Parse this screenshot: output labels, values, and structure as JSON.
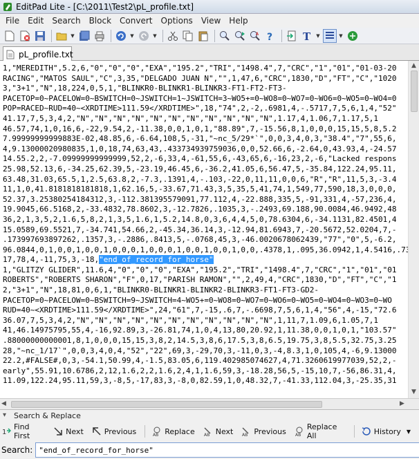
{
  "window": {
    "title": "EditPad Lite - [C:\\2011\\Test2\\pL_profile.txt]"
  },
  "menu": [
    "File",
    "Edit",
    "Search",
    "Block",
    "Convert",
    "Options",
    "View",
    "Help"
  ],
  "tab": {
    "label": "pL_profile.txt"
  },
  "editor": {
    "lines_before": [
      "1,\"MEREDITH\",5.2,6,\"0\",\"0\",\"0\",\"EXA\",\"195.2\",\"TRI\",\"1498.4\",7,\"CRC\",\"1\",\"01\",\"01-03-20",
      "RACING\",\"MATOS SAUL\",\"C\",3,35,\"DELGADO JUAN N\",\"\",1,47,6,\"CRC\",1830,\"D\",\"FT\",\"C\",\"1020",
      "3,\"3+1\",\"N\",18,224,0,5,1,\"BLINKR0-BLINKR1-BLINKR3-FT1-FT2-FT3-",
      "PACETOP=0~PACELOW=0~BSWITCH=0~JSWITCH=1~JSWITCH=3~WO5+=0~WO8=0~WO7=0~WO6=0~WO5=0~WO4=0",
      "POP=RACED~RUD=40~<XRDTIME>111.59</XRDTIME>\",18,\"74\",2,-2,.6981,4,-.5717,7,5,6,1,4,\"52\"",
      "41.17,7,5,3,4,2,\"N\",\"N\",\"N\",\"N\",\"N\",\"N\",\"N\",\"N\",\"N\",\"N\",\"N\",1.17,4,1.06,7,1.17,5,1",
      "46.57,74,1,0,16,6,-22,9.54,2,-11.38,0,0,1,0,1,\"88.89\",7,-15.56,8,1,0,0,0,15,15,5,8,5.2",
      "7.99999999999883E-02,48.85,6,-6.64,108,5,-31,\"~nc_5/29*`\",0,0,3,4,0,3,\"38.4\",\"7\",55,6,",
      "4,9.13000020980835,1,0,18,74,63,43,.433734939759036,0,0,52.66,6,-2.64,0,43.93,4,-24.57",
      "14.55.2,2,-7.09999999999999,52,2,-6,33,4,-61,55,6,-43,65,6,-16,23,2,-6,\"Lacked respons",
      "25.98,52.13,6,-34.25,62.39,5,-23.19,46.45,6,-36.2,41.05,6,56.47,5,-35.84,122.24,95.11,",
      "63.48,31.03,65.5,1,2.5,63.8,2,-7.3,.1391,4,-.103,-22,0,11,11,0,0,6,\"R\",\"R\",11,5,3,-3.4",
      "11,1,0,41.8181818181818,1,62.16,5,-33.67,71.43,3,5,35,5,41,74,1,549,77,590,18,3,0,0,0,",
      "52.37,3.25380254184312,3,-112.381395579091,77.112,4,-22.888,335,5,-91,331,4,-57,236,4,",
      "19.9045,66.5168,2,-33.4832,78.8602,3,-12.7826,.1035,3,-.2493,69.188,90.0084,46.9492,48",
      "36,2,1,3,5,2,1.6,5,8,2,1,3,5,1.6,1,5.2,14.8,0,3,6,4,4,5,0,78.6304,6,-34.1131,82.4501,4",
      "15.0589,69.5521,7,-34.741,54.66,2,-45.34,36.14,3,-12.94,81.6943,7,-20.5672,52.0204,7,-",
      ".173997693897262,.1357,3,-.2886,.8413,5,-.0768,45,3,-46.0020678062439,\"77\",\"0\",5,-6.2,",
      "96.0844,0,1,0,0,1,0,0,1,0,0,0,1,0,0,0,1,0,0,1,0,0,1,0,0,.4378,1,.095,36.0942,1,4.5416,.7346,",
      "17,78,4,-11,75,3,-18,"
    ],
    "selected_text": "\"end_of_record_for_horse\"",
    "lines_after": [
      "1,\"GLITZY GLIDER\",11.6,4,\"0\",\"0\",\"0\",\"EXA\",\"195.2\",\"TRI\",\"1498.4\",7,\"CRC\",\"1\",\"01\",\"01",
      "ROBERTS\",\"ROBERTS SHARON\",\"F\",0,17,\"PARISH RAMON\",\"\",2,49,4,\"CRC\",1830,\"D\",\"FT\",\"C\",\"1",
      "2,\"3+1\",\"N\",18,81,0,6,1,\"BLINKR0-BLINKR1-BLINKR2-BLINKR3-FT1-FT3-GD2-",
      "PACETOP=0~PACELOW=0~BSWITCH=9~JSWITCH=4~WO5+=0~WO8=0~WO7=0~WO6=0~WO5=0~WO4=0~WO3=0~WO",
      "RUD=40~<XRDTIME>111.59</XRDTIME>\",24,\"61\",7,-15,.6,7,-.6698,7,5,6,1,4,\"56\",4,-15,\"72.6",
      "36.07,7,5,3,4,2,\"N\",\"N\",\"N\",\"N\",\"N\",\"N\",\"N\",\"N\",\"N\",\"N\",\"N\",1,11,7,1.09,6,1.05,7,1",
      "41,46.14975795,55,4,-16,92.89,3,-26.81,74,1,0,4,13,80,20.92,1,11.38,0,0,1,0,1,\"103.57\"",
      ".88000000000001,8,1,0,0,0,15,15,3,8,2,14.5,3,8,6,17.5,3,8,6.5,19.75,3,8,5.5,32.75,3.25",
      "28,\"~nc_1/17`\",0,0,3,4,0,4,\"52\",\"22\",69,3,-29,70,3,-11,0,3,-4,8.3,1,0,105,4,-6,9.13000",
      "22.2,#FALSE#,0,3,-54.1,50.99,4,-1.5,83.05,6,119.402985074627,4,71.3260619977039,52,2,-",
      "early\",55.91,10.6786,2,12,1.6,2,2,1.6,2,4,1,1.6,59,3,-18.28,56,5,-15,10,7,-56,86.31,4,",
      "11.09,122.24,95.11,59,3,-8,5,-17,83,3,-8,0,82.59,1,0,48.32,7,-41.33,112.04,3,-25.35,31"
    ]
  },
  "search_replace": {
    "title": "Search & Replace",
    "buttons": {
      "find_first": "Find First",
      "next": "Next",
      "previous": "Previous",
      "replace": "Replace",
      "replace_next": "Next",
      "replace_previous": "Previous",
      "replace_all": "Replace All",
      "history": "History"
    },
    "search_label": "Search:",
    "search_value": "\"end_of_record_for_horse\""
  }
}
